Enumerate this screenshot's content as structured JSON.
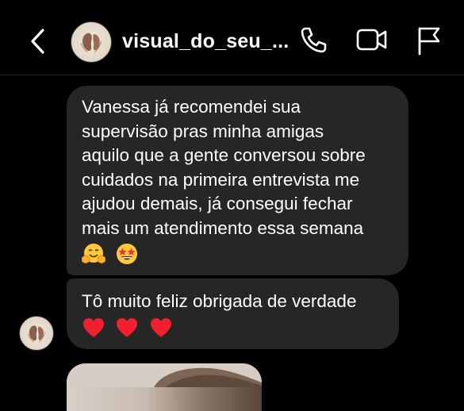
{
  "header": {
    "username": "visual_do_seu_...",
    "back_icon": "chevron-left-icon",
    "call_icon": "phone-icon",
    "video_icon": "video-camera-icon",
    "report_icon": "flag-icon"
  },
  "messages": [
    {
      "lines": [
        "Vanessa já recomendei sua",
        "supervisão pras minha amigas",
        "aquilo que a gente conversou sobre",
        "cuidados na primeira entrevista me",
        "ajudou demais, já consegui fechar",
        "mais um atendimento essa semana"
      ],
      "emojis": [
        "hugging-face-icon",
        "star-struck-icon"
      ]
    },
    {
      "lines": [
        "Tô muito feliz obrigada de verdade"
      ],
      "emojis": [
        "red-heart-icon",
        "red-heart-icon",
        "red-heart-icon"
      ]
    }
  ],
  "colors": {
    "background": "#000000",
    "bubble": "#262626",
    "text": "#ffffff"
  }
}
